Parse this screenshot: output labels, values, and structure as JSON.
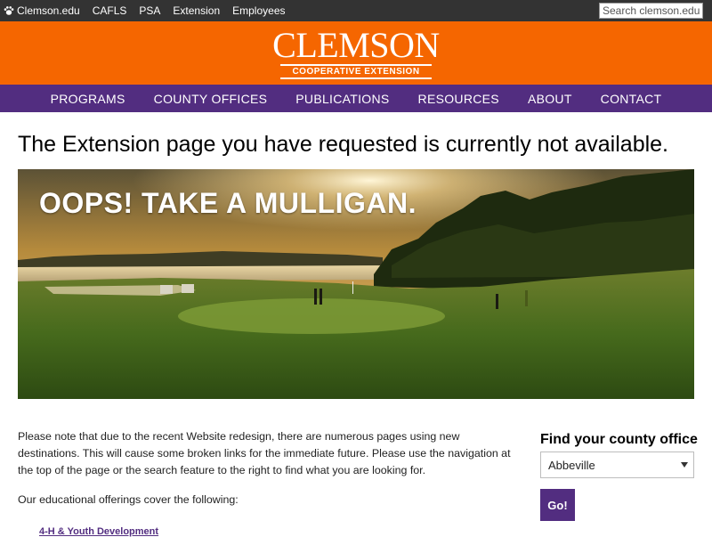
{
  "topbar": {
    "links": [
      "Clemson.edu",
      "CAFLS",
      "PSA",
      "Extension",
      "Employees"
    ],
    "search_placeholder": "Search clemson.edu"
  },
  "brand": {
    "wordmark": "CLEMSON",
    "subtitle": "COOPERATIVE EXTENSION",
    "background": "#F56600"
  },
  "nav": {
    "items": [
      "PROGRAMS",
      "COUNTY OFFICES",
      "PUBLICATIONS",
      "RESOURCES",
      "ABOUT",
      "CONTACT"
    ],
    "background": "#522D80"
  },
  "page": {
    "heading": "The Extension page you have requested is currently not available."
  },
  "hero": {
    "headline": "OOPS! TAKE A MULLIGAN."
  },
  "content": {
    "intro": "Please note that due to the recent Website redesign, there are numerous pages using new destinations. This will cause some broken links for the immediate future. Please use the navigation at the top of the page or the search feature to the right to find what you are looking for.",
    "offerings_intro": "Our educational offerings cover the following:",
    "offerings": [
      "4-H & Youth Development"
    ]
  },
  "county_finder": {
    "title": "Find your county office",
    "selected": "Abbeville",
    "button": "Go!"
  },
  "icons": {
    "clemson_link": "tiger-paw-icon",
    "select": "chevron-down-icon"
  }
}
